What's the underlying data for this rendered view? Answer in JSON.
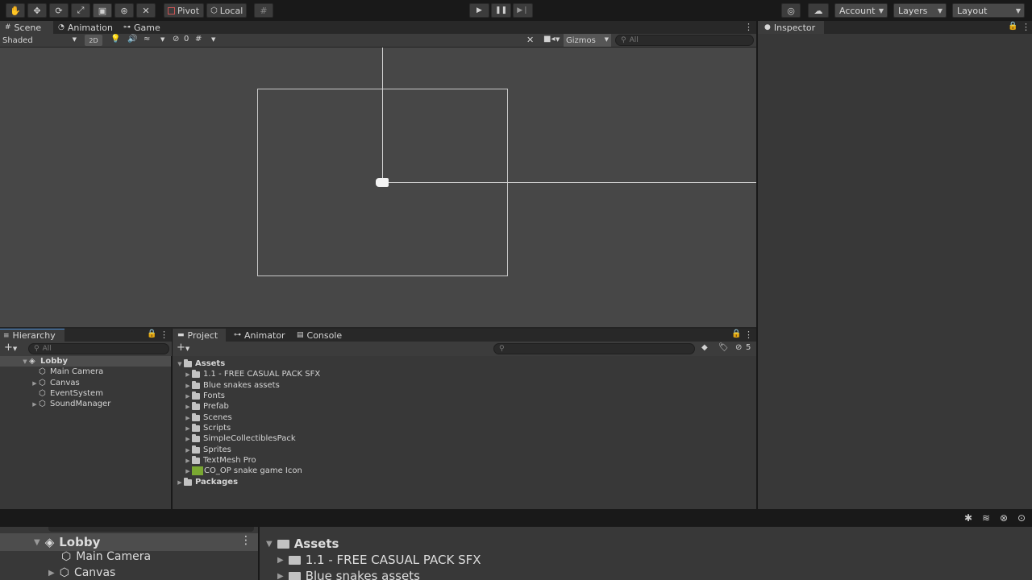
{
  "toolbar": {
    "pivot_label": "Pivot",
    "local_label": "Local",
    "account_label": "Account",
    "layers_label": "Layers",
    "layout_label": "Layout"
  },
  "scene_tabs": {
    "scene": "Scene",
    "animation": "Animation",
    "game": "Game"
  },
  "scene_toolbar": {
    "shading": "Shaded",
    "mode_2d": "2D",
    "hidden_count": "0",
    "gizmos": "Gizmos",
    "search_placeholder": "All"
  },
  "inspector": {
    "title": "Inspector"
  },
  "hierarchy": {
    "title": "Hierarchy",
    "search_placeholder": "All",
    "scene_name": "Lobby",
    "items": [
      {
        "label": "Main Camera"
      },
      {
        "label": "Canvas"
      },
      {
        "label": "EventSystem"
      },
      {
        "label": "SoundManager"
      }
    ]
  },
  "project": {
    "tabs": [
      "Project",
      "Animator",
      "Console"
    ],
    "root": "Assets",
    "hidden_count": "5",
    "folders": [
      {
        "label": "1.1 - FREE CASUAL PACK SFX"
      },
      {
        "label": "Blue snakes assets"
      },
      {
        "label": "Fonts"
      },
      {
        "label": "Prefab"
      },
      {
        "label": "Scenes"
      },
      {
        "label": "Scripts"
      },
      {
        "label": "SimpleCollectiblesPack"
      },
      {
        "label": "Sprites"
      },
      {
        "label": "TextMesh Pro"
      }
    ],
    "asset_file": "CO_OP snake game Icon",
    "packages": "Packages"
  },
  "zoom": {
    "hierarchy_root": "Lobby",
    "hierarchy_items": [
      "Main Camera",
      "Canvas"
    ],
    "project_root": "Assets",
    "project_items": [
      "1.1 - FREE CASUAL PACK SFX",
      "Blue snakes assets"
    ]
  },
  "colors": {
    "scene_bg": "#474747",
    "panel_bg": "#383838",
    "toolbar_bg": "#191919",
    "accent_icon": "#7aa832"
  }
}
